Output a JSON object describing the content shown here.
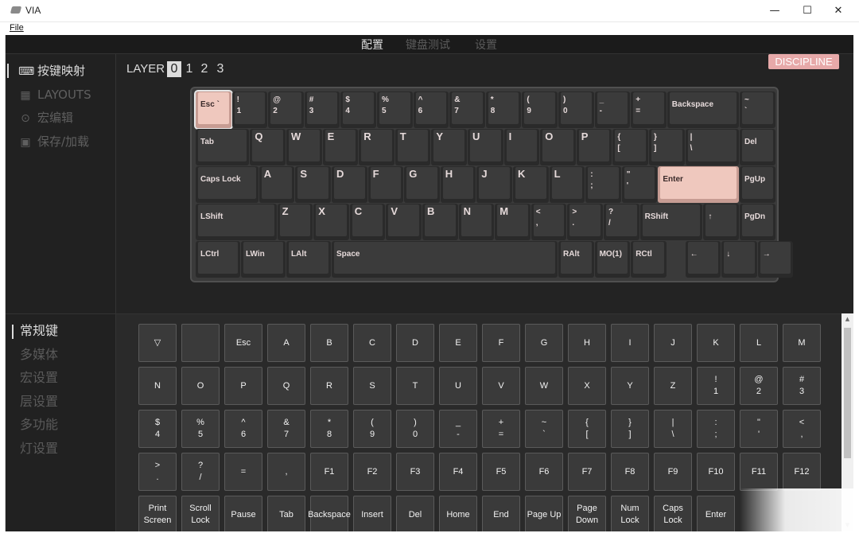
{
  "window": {
    "title": "VIA",
    "minimize": "—",
    "maximize": "☐",
    "close": "✕"
  },
  "menu": {
    "file": "File"
  },
  "topnav": [
    "配置",
    "键盘测试",
    "设置"
  ],
  "sidebar": [
    {
      "icon": "keyboard-icon",
      "label": "按键映射",
      "active": true
    },
    {
      "icon": "layouts-icon",
      "label": "LAYOUTS",
      "active": false
    },
    {
      "icon": "macro-icon",
      "label": "宏编辑",
      "active": false
    },
    {
      "icon": "save-icon",
      "label": "保存/加载",
      "active": false
    }
  ],
  "layer": {
    "label": "LAYER",
    "numbers": [
      "0",
      "1",
      "2",
      "3"
    ],
    "selected": "0"
  },
  "badge": "DISCIPLINE",
  "keyboard_rows": [
    [
      "Esc `",
      "!\n1",
      "@\n2",
      "#\n3",
      "$\n4",
      "%\n5",
      "^\n6",
      "&\n7",
      "*\n8",
      "(\n9",
      ")\n0",
      "_\n-",
      "+\n=",
      "Backspace",
      "~\n`"
    ],
    [
      "Tab",
      "Q",
      "W",
      "E",
      "R",
      "T",
      "Y",
      "U",
      "I",
      "O",
      "P",
      "{\n[",
      "}\n]",
      "|\n\\",
      "Del"
    ],
    [
      "Caps Lock",
      "A",
      "S",
      "D",
      "F",
      "G",
      "H",
      "J",
      "K",
      "L",
      ":\n;",
      "\"\n'",
      "Enter",
      "PgUp"
    ],
    [
      "LShift",
      "Z",
      "X",
      "C",
      "V",
      "B",
      "N",
      "M",
      "<\n,",
      ">\n.",
      "?\n/",
      "RShift",
      "↑",
      "PgDn"
    ],
    [
      "LCtrl",
      "LWin",
      "LAlt",
      "Space",
      "RAlt",
      "MO(1)",
      "RCtl",
      "←",
      "↓",
      "→"
    ]
  ],
  "categories": [
    {
      "label": "常规键",
      "active": true
    },
    {
      "label": "多媒体",
      "active": false
    },
    {
      "label": "宏设置",
      "active": false
    },
    {
      "label": "层设置",
      "active": false
    },
    {
      "label": "多功能",
      "active": false
    },
    {
      "label": "灯设置",
      "active": false
    }
  ],
  "palette_rows": [
    [
      "▽",
      "",
      "Esc",
      "A",
      "B",
      "C",
      "D",
      "E",
      "F",
      "G",
      "H",
      "I",
      "J",
      "K",
      "L",
      "M"
    ],
    [
      "N",
      "O",
      "P",
      "Q",
      "R",
      "S",
      "T",
      "U",
      "V",
      "W",
      "X",
      "Y",
      "Z",
      "!\n1",
      "@\n2",
      "#\n3"
    ],
    [
      "$\n4",
      "%\n5",
      "^\n6",
      "&\n7",
      "*\n8",
      "(\n9",
      ")\n0",
      "_\n-",
      "+\n=",
      "~\n`",
      "{\n[",
      "}\n]",
      "|\n\\",
      ":\n;",
      "\"\n'",
      "<\n,"
    ],
    [
      ">\n.",
      "?\n/",
      "=",
      ",",
      "F1",
      "F2",
      "F3",
      "F4",
      "F5",
      "F6",
      "F7",
      "F8",
      "F9",
      "F10",
      "F11",
      "F12"
    ],
    [
      "Print\nScreen",
      "Scroll\nLock",
      "Pause",
      "Tab",
      "Backspace",
      "Insert",
      "Del",
      "Home",
      "End",
      "Page Up",
      "Page\nDown",
      "Num\nLock",
      "Caps\nLock",
      "Enter"
    ]
  ],
  "colors": {
    "background": "#232323",
    "accent_key": "#efc8be",
    "badge": "#e7a9a9"
  }
}
